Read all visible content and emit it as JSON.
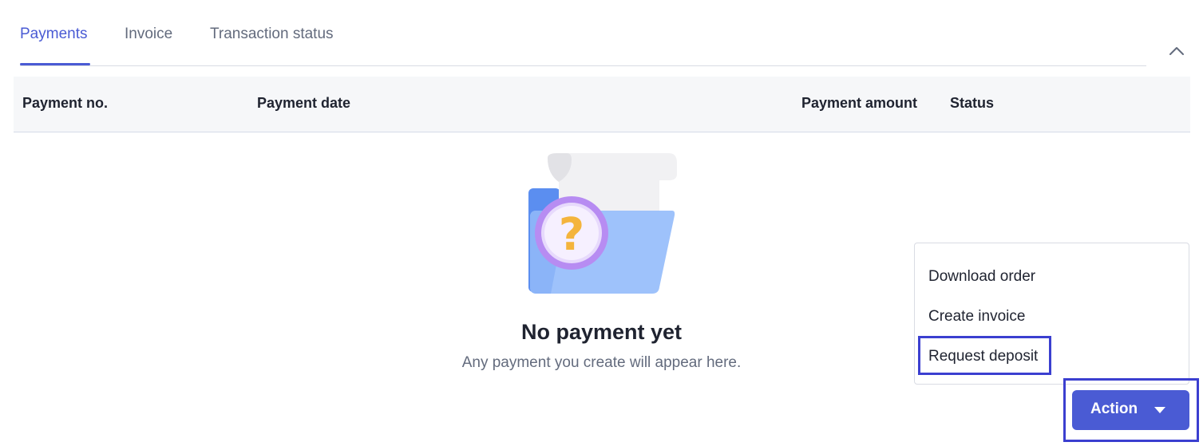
{
  "tabs": [
    {
      "label": "Payments",
      "active": true
    },
    {
      "label": "Invoice",
      "active": false
    },
    {
      "label": "Transaction status",
      "active": false
    }
  ],
  "table": {
    "columns": [
      "Payment no.",
      "Payment date",
      "Payment amount",
      "Status"
    ]
  },
  "empty_state": {
    "title": "No payment yet",
    "subtitle": "Any payment you create will appear here.",
    "icon": "empty-folder-question-icon"
  },
  "menu": {
    "items": [
      "Download order",
      "Create invoice",
      "Request deposit"
    ]
  },
  "action_button": {
    "label": "Action",
    "icon": "caret-down-icon"
  },
  "colors": {
    "accent": "#4a5bd4",
    "highlight": "#3b3fd0",
    "text": "#1f2330",
    "muted": "#636b7d"
  }
}
